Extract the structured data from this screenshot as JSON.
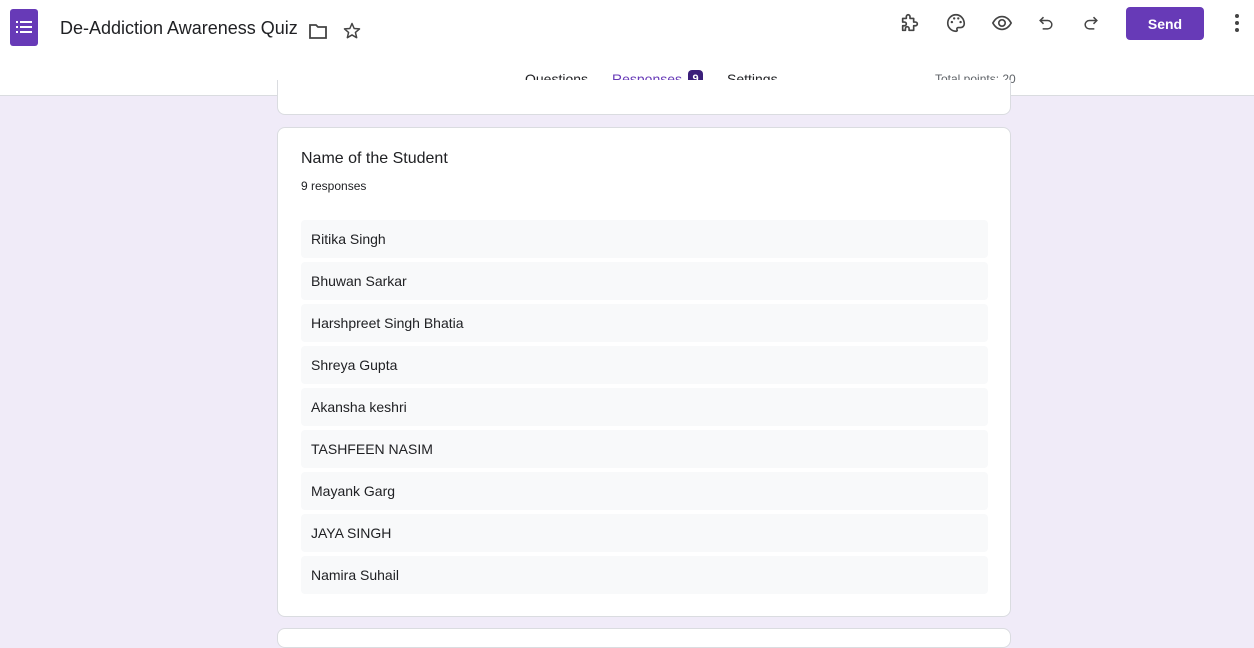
{
  "header": {
    "title": "De-Addiction Awareness Quiz",
    "send_label": "Send",
    "icons": [
      "forms-logo-icon",
      "folder-icon",
      "star-icon",
      "addon-puzzle-icon",
      "palette-icon",
      "preview-eye-icon",
      "undo-icon",
      "redo-icon",
      "more-vert-icon"
    ],
    "accent_color": "#673ab7",
    "background_color": "#f0ebf8"
  },
  "tabs": [
    {
      "label": "Questions"
    },
    {
      "label": "Responses",
      "badge": "9",
      "active": true
    },
    {
      "label": "Settings"
    }
  ],
  "total_points": "Total points: 20",
  "question": {
    "title": "Name of the Student",
    "count_text": "9 responses",
    "responses": [
      "Ritika Singh",
      "Bhuwan Sarkar",
      "Harshpreet Singh Bhatia",
      "Shreya Gupta",
      "Akansha keshri",
      "TASHFEEN NASIM",
      "Mayank Garg",
      "JAYA SINGH",
      "Namira Suhail"
    ]
  }
}
